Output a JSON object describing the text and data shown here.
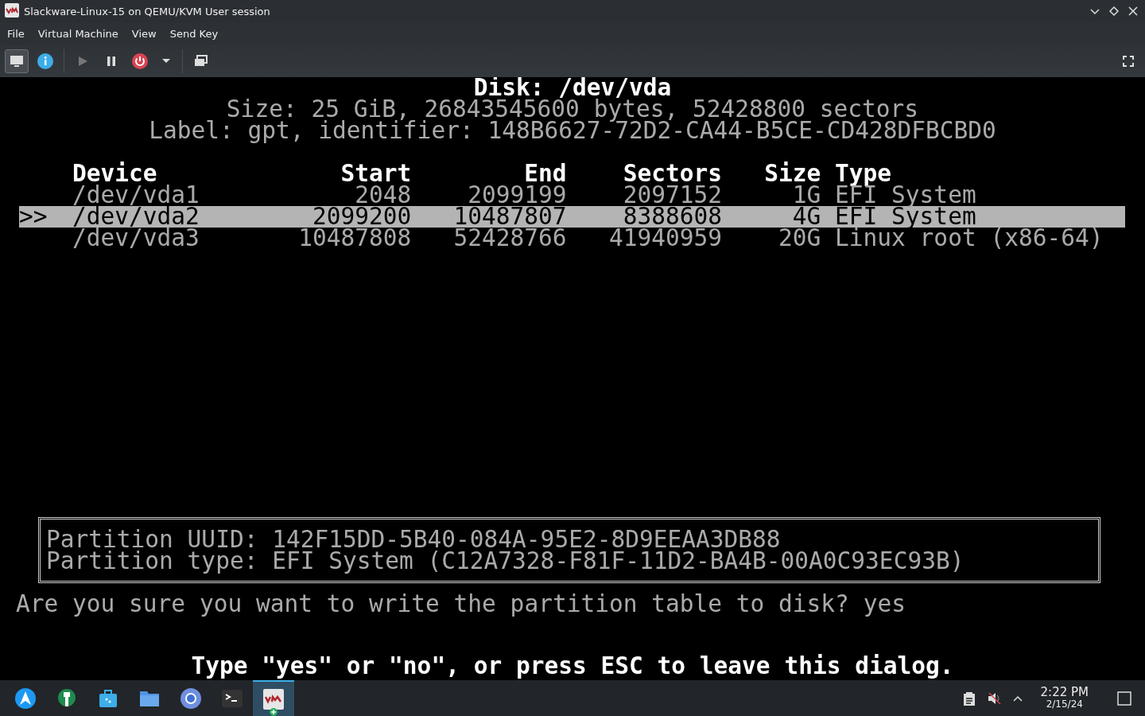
{
  "window": {
    "title": "Slackware-Linux-15 on QEMU/KVM User session"
  },
  "menu": [
    "File",
    "Virtual Machine",
    "View",
    "Send Key"
  ],
  "toolbar": [
    {
      "kind": "console",
      "selected": true
    },
    {
      "kind": "details",
      "selected": false
    },
    {
      "kind": "run",
      "selected": false
    },
    {
      "kind": "pause",
      "selected": false
    },
    {
      "kind": "shutdown",
      "selected": false
    },
    {
      "kind": "dropdown",
      "selected": false
    },
    {
      "kind": "snapshots",
      "selected": false
    }
  ],
  "console": {
    "header": [
      "Disk: /dev/vda",
      "Size: 25 GiB, 26843545600 bytes, 52428800 sectors",
      "Label: gpt, identifier: 148B6627-72D2-CA44-B5CE-CD428DFBCBD0"
    ],
    "cursor": ">>",
    "columns": [
      "Device",
      "Start",
      "End",
      "Sectors",
      "Size",
      "Type"
    ],
    "rows": [
      {
        "selected": false,
        "cells": [
          "/dev/vda1",
          "2048",
          "2099199",
          "2097152",
          "1G",
          "EFI System"
        ]
      },
      {
        "selected": true,
        "cells": [
          "/dev/vda2",
          "2099200",
          "10487807",
          "8388608",
          "4G",
          "EFI System"
        ]
      },
      {
        "selected": false,
        "cells": [
          "/dev/vda3",
          "10487808",
          "52428766",
          "41940959",
          "20G",
          "Linux root (x86-64)"
        ]
      }
    ],
    "info": [
      "Partition UUID: 142F15DD-5B40-084A-95E2-8D9EEAA3DB88",
      "Partition type: EFI System (C12A7328-F81F-11D2-BA4B-00A0C93EC93B)"
    ],
    "prompt": "Are you sure you want to write the partition table to disk? yes",
    "hint": "Type \"yes\" or \"no\", or press ESC to leave this dialog."
  },
  "taskbar": {
    "apps": [
      {
        "kind": "launcher",
        "selected": false
      },
      {
        "kind": "settings",
        "selected": false
      },
      {
        "kind": "store",
        "selected": false
      },
      {
        "kind": "files",
        "selected": false
      },
      {
        "kind": "browser",
        "selected": false
      },
      {
        "kind": "terminal",
        "selected": false
      },
      {
        "kind": "vm",
        "selected": true
      }
    ],
    "clock": {
      "time": "2:22 PM",
      "date": "2/15/24"
    }
  }
}
